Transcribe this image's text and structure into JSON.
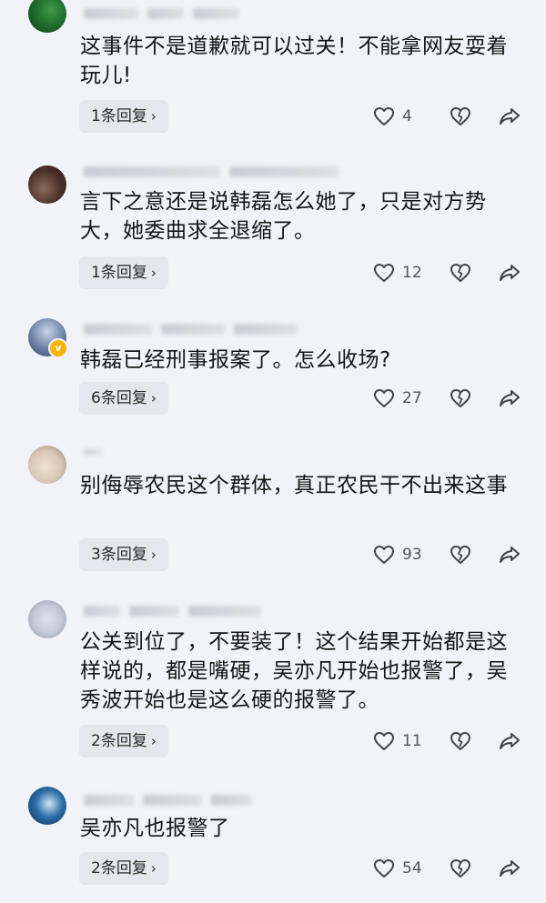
{
  "comments": [
    {
      "text": "这事件不是道歉就可以过关！不能拿网友耍着玩儿!",
      "reply_label": "1条回复",
      "likes": "4",
      "avatar_colors": [
        "#1f6b2c",
        "#0e3a14"
      ]
    },
    {
      "text": "言下之意还是说韩磊怎么她了，只是对方势大，她委曲求全退缩了。",
      "reply_label": "1条回复",
      "likes": "12",
      "avatar_colors": [
        "#6b4a3a",
        "#2b1a18"
      ]
    },
    {
      "text": "韩磊已经刑事报案了。怎么收场?",
      "reply_label": "6条回复",
      "likes": "27",
      "avatar_colors": [
        "#36486b",
        "#c8d4e6"
      ],
      "verified": true,
      "badge_symbol": "v"
    },
    {
      "text": "别侮辱农民这个群体，真正农民干不出来这事",
      "reply_label": "3条回复",
      "likes": "93",
      "avatar_colors": [
        "#d9c8b8",
        "#9c8a7a"
      ]
    },
    {
      "text": "公关到位了，不要装了！这个结果开始都是这样说的，都是嘴硬，吴亦凡开始也报警了，吴秀波开始也是这么硬的报警了。",
      "reply_label": "2条回复",
      "likes": "11",
      "avatar_colors": [
        "#c5cad6",
        "#8f97a8"
      ]
    },
    {
      "text": "吴亦凡也报警了",
      "reply_label": "2条回复",
      "likes": "54",
      "avatar_colors": [
        "#2e6fa8",
        "#0d2f55"
      ]
    }
  ],
  "icons": {
    "reply_chevron": "chevron-right-icon",
    "like": "heart-outline-icon",
    "dislike": "broken-heart-icon",
    "share": "share-arrow-icon"
  },
  "colors": {
    "background": "#f1f3f8",
    "reply_button_bg": "#e4e7ee",
    "icon_stroke": "#444444",
    "verified_badge": "#f5b50a"
  }
}
